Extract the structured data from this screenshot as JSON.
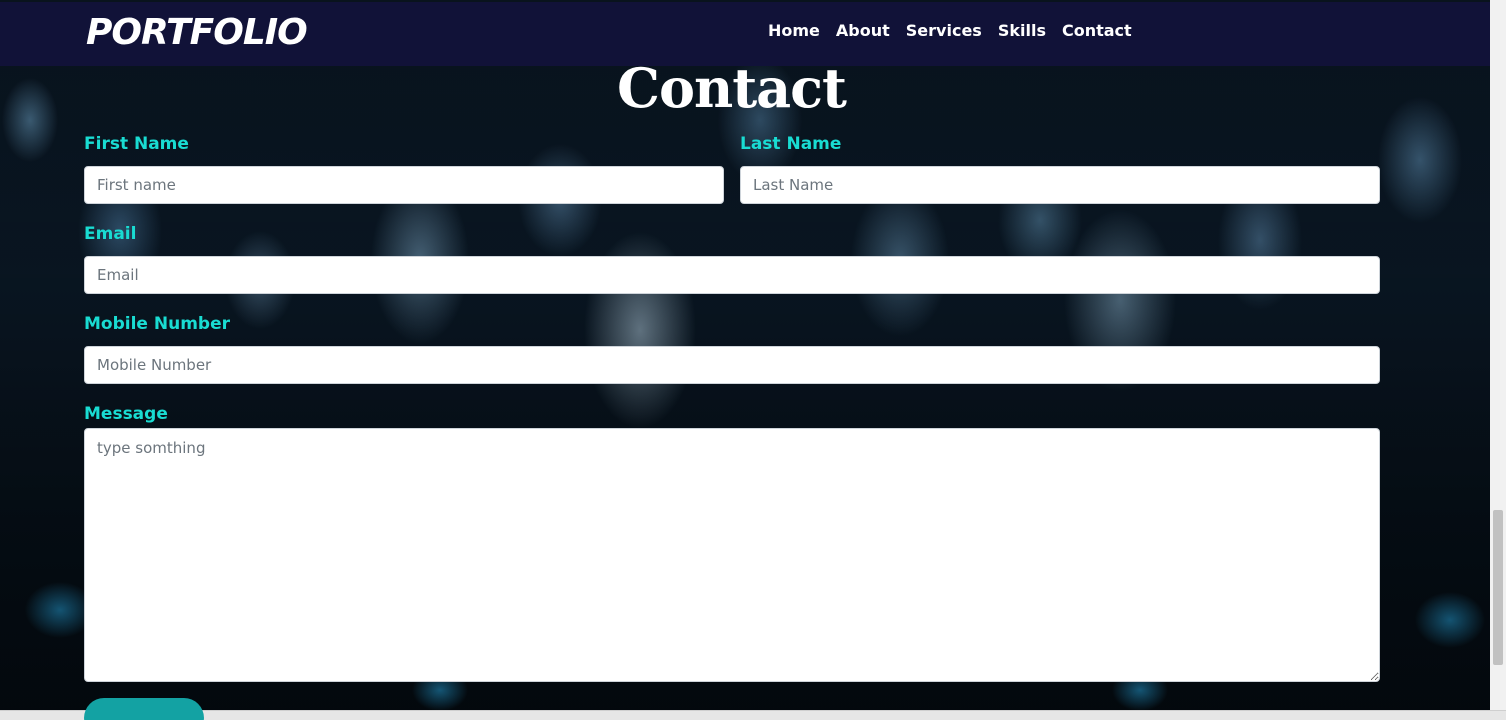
{
  "navbar": {
    "brand": "PORTFOLIO",
    "links": [
      {
        "label": "Home"
      },
      {
        "label": "About"
      },
      {
        "label": "Services"
      },
      {
        "label": "Skills"
      },
      {
        "label": "Contact"
      }
    ]
  },
  "contact": {
    "title": "Contact",
    "first_name": {
      "label": "First Name",
      "placeholder": "First name"
    },
    "last_name": {
      "label": "Last Name",
      "placeholder": "Last Name"
    },
    "email": {
      "label": "Email",
      "placeholder": "Email"
    },
    "mobile": {
      "label": "Mobile Number",
      "placeholder": "Mobile Number"
    },
    "message": {
      "label": "Message",
      "placeholder": "type somthing"
    }
  },
  "colors": {
    "navbar_bg": "#12123a",
    "label": "#19dcd2",
    "button": "#13a2a3"
  }
}
